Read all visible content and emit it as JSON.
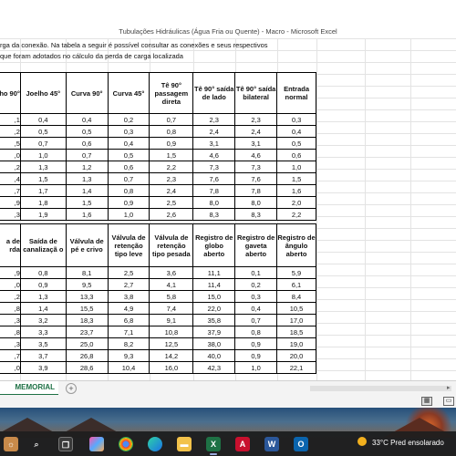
{
  "window": {
    "title": "Tubulações Hidráulicas (Água Fria ou Quente) - Macro - Microsoft Excel"
  },
  "sheet_text": {
    "line1": "rga da conexão. Na tabela a seguir é possível consultar as conexões e seus respectivos",
    "line2": "que foram adotados no cálculo da perda de carga localizada"
  },
  "table1": {
    "headers": [
      "ho 90°",
      "Joelho 45°",
      "Curva 90°",
      "Curva 45°",
      "Tê 90° passagem direta",
      "Tê 90° saída de lado",
      "Tê 90° saída bilateral",
      "Entrada normal"
    ],
    "rows": [
      [
        ",1",
        "0,4",
        "0,4",
        "0,2",
        "0,7",
        "2,3",
        "2,3",
        "0,3"
      ],
      [
        ",2",
        "0,5",
        "0,5",
        "0,3",
        "0,8",
        "2,4",
        "2,4",
        "0,4"
      ],
      [
        ",5",
        "0,7",
        "0,6",
        "0,4",
        "0,9",
        "3,1",
        "3,1",
        "0,5"
      ],
      [
        ",0",
        "1,0",
        "0,7",
        "0,5",
        "1,5",
        "4,6",
        "4,6",
        "0,6"
      ],
      [
        ",2",
        "1,3",
        "1,2",
        "0,6",
        "2,2",
        "7,3",
        "7,3",
        "1,0"
      ],
      [
        ",4",
        "1,5",
        "1,3",
        "0,7",
        "2,3",
        "7,6",
        "7,6",
        "1,5"
      ],
      [
        ",7",
        "1,7",
        "1,4",
        "0,8",
        "2,4",
        "7,8",
        "7,8",
        "1,6"
      ],
      [
        ",9",
        "1,8",
        "1,5",
        "0,9",
        "2,5",
        "8,0",
        "8,0",
        "2,0"
      ],
      [
        ",3",
        "1,9",
        "1,6",
        "1,0",
        "2,6",
        "8,3",
        "8,3",
        "2,2"
      ]
    ]
  },
  "table2": {
    "headers": [
      "a de rda",
      "Saída de canalizaçã o",
      "Válvula de pé e crivo",
      "Válvula de retenção tipo leve",
      "Válvula de retenção tipo pesada",
      "Registro de globo aberto",
      "Registro de gaveta aberto",
      "Registro de ângulo aberto"
    ],
    "rows": [
      [
        ",9",
        "0,8",
        "8,1",
        "2,5",
        "3,6",
        "11,1",
        "0,1",
        "5,9"
      ],
      [
        ",0",
        "0,9",
        "9,5",
        "2,7",
        "4,1",
        "11,4",
        "0,2",
        "6,1"
      ],
      [
        ",2",
        "1,3",
        "13,3",
        "3,8",
        "5,8",
        "15,0",
        "0,3",
        "8,4"
      ],
      [
        ",8",
        "1,4",
        "15,5",
        "4,9",
        "7,4",
        "22,0",
        "0,4",
        "10,5"
      ],
      [
        ",3",
        "3,2",
        "18,3",
        "6,8",
        "9,1",
        "35,8",
        "0,7",
        "17,0"
      ],
      [
        ",8",
        "3,3",
        "23,7",
        "7,1",
        "10,8",
        "37,9",
        "0,8",
        "18,5"
      ],
      [
        ",3",
        "3,5",
        "25,0",
        "8,2",
        "12,5",
        "38,0",
        "0,9",
        "19,0"
      ],
      [
        ",7",
        "3,7",
        "26,8",
        "9,3",
        "14,2",
        "40,0",
        "0,9",
        "20,0"
      ],
      [
        ",0",
        "3,9",
        "28,6",
        "10,4",
        "16,0",
        "42,3",
        "1,0",
        "22,1"
      ]
    ]
  },
  "tabs": {
    "active": "MEMORIAL",
    "add_symbol": "+"
  },
  "taskbar": {
    "weather": "33°C  Pred ensolarado",
    "apps": [
      "search",
      "task-view",
      "file-explorer",
      "copilot",
      "chrome",
      "edge",
      "store",
      "excel",
      "pdf",
      "word",
      "outlook"
    ]
  }
}
